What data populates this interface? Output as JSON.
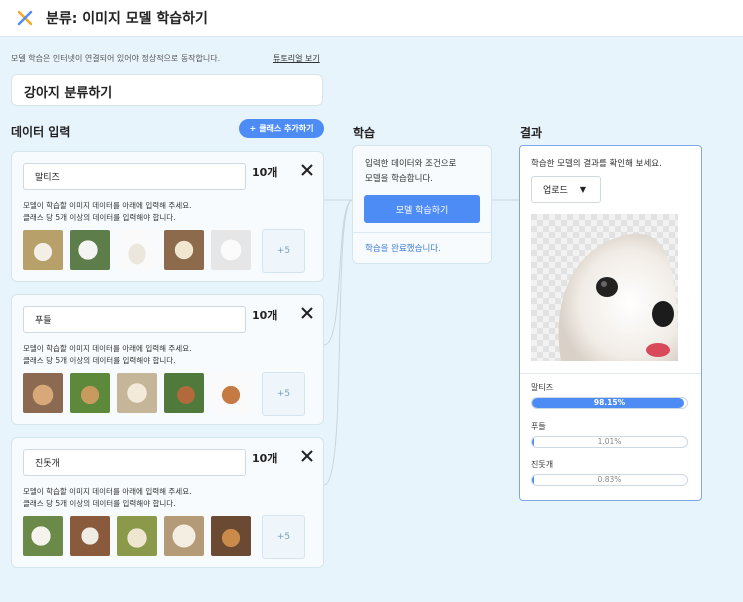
{
  "header": {
    "title": "분류: 이미지 모델 학습하기"
  },
  "notice": "모델 학습은 인터넷이 연결되어 있어야 정상적으로 동작합니다.",
  "tutorial_link": "튜토리얼 보기",
  "project_name": "강아지 분류하기",
  "data_input": {
    "title": "데이터 입력",
    "add_class_label": "클래스 추가하기",
    "classes": [
      {
        "name": "말티즈",
        "count": "10개",
        "desc1": "모델이 학습할 이미지 데이터를 아래에 입력해 주세요.",
        "desc2": "클래스 당 5개 이상의 데이터를 입력해야 합니다.",
        "more": "+5"
      },
      {
        "name": "푸들",
        "count": "10개",
        "desc1": "모델이 학습할 이미지 데이터를 아래에 입력해 주세요.",
        "desc2": "클래스 당 5개 이상의 데이터를 입력해야 합니다.",
        "more": "+5"
      },
      {
        "name": "진돗개",
        "count": "10개",
        "desc1": "모델이 학습할 이미지 데이터를 아래에 입력해 주세요.",
        "desc2": "클래스 당 5개 이상의 데이터를 입력해야 합니다.",
        "more": "+5"
      }
    ]
  },
  "training": {
    "title": "학습",
    "desc1": "입력한 데이터와 조건으로",
    "desc2": "모델을 학습합니다.",
    "button": "모델 학습하기",
    "status": "학습을 완료했습니다."
  },
  "result": {
    "title": "결과",
    "desc": "학습한 모델의 결과를 확인해 보세요.",
    "upload_label": "업로드",
    "predictions": [
      {
        "label": "말티즈",
        "percent": "98.15%",
        "value": 0.9815
      },
      {
        "label": "푸들",
        "percent": "1.01%",
        "value": 0.0101
      },
      {
        "label": "진돗개",
        "percent": "0.83%",
        "value": 0.0083
      }
    ]
  },
  "colors": {
    "accent": "#4e8cf5",
    "background": "#e8f4fb",
    "logo_orange": "#f5a623",
    "logo_blue": "#4e8cf5"
  },
  "icons": [
    "logo-icon",
    "close-icon",
    "plus-icon",
    "caret-down-icon",
    "dog-photo"
  ]
}
